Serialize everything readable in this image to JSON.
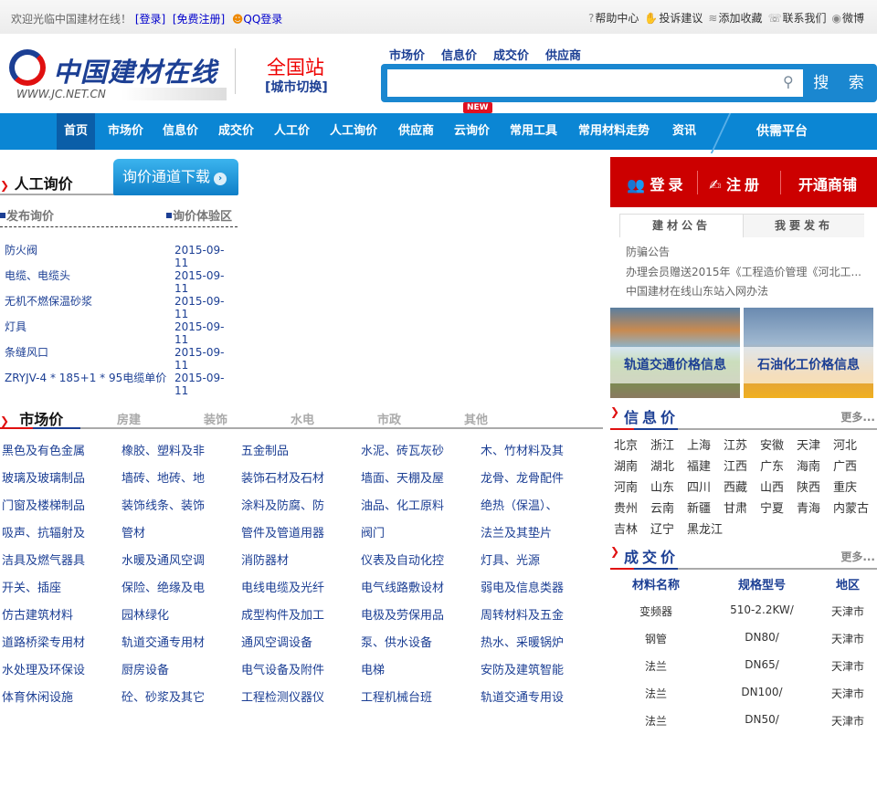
{
  "topbar": {
    "welcome": "欢迎光临中国建材在线！",
    "login": "[登录]",
    "register": "[免费注册]",
    "qq_login": "QQ登录",
    "links": [
      {
        "icon": "help-icon",
        "glyph": "?",
        "label": "帮助中心"
      },
      {
        "icon": "complaint-icon",
        "glyph": "✋",
        "label": "投诉建议"
      },
      {
        "icon": "bookmark-icon",
        "glyph": "≋",
        "label": "添加收藏"
      },
      {
        "icon": "phone-icon",
        "glyph": "☏",
        "label": "联系我们"
      },
      {
        "icon": "weibo-icon",
        "glyph": "◉",
        "label": "微博"
      }
    ]
  },
  "header": {
    "logo_text": "中国建材在线",
    "logo_url": "WWW.JC.NET.CN",
    "station": "全国站",
    "city_switch": "[城市切换]",
    "search_tabs": [
      "市场价",
      "信息价",
      "成交价",
      "供应商"
    ],
    "search_value": "",
    "search_button": "搜 索"
  },
  "nav": {
    "items": [
      "首页",
      "市场价",
      "信息价",
      "成交价",
      "人工价",
      "人工询价",
      "供应商",
      "云询价",
      "常用工具",
      "常用材料走势",
      "资讯",
      "供需平台"
    ],
    "active": "首页",
    "new_badge": "NEW"
  },
  "inquiry": {
    "title": "人工询价",
    "download": "询价通道下载",
    "publish": "发布询价",
    "experience": "询价体验区",
    "rows": [
      {
        "name": "防火阀",
        "date": "2015-09-11"
      },
      {
        "name": "电缆、电缆头",
        "date": "2015-09-11"
      },
      {
        "name": "无机不燃保温砂浆",
        "date": "2015-09-11"
      },
      {
        "name": "灯具",
        "date": "2015-09-11"
      },
      {
        "name": "条缝风口",
        "date": "2015-09-11"
      },
      {
        "name": "ZRYJV-4 * 185+1 * 95电缆单价",
        "date": "2015-09-11"
      }
    ]
  },
  "market": {
    "title": "市场价",
    "tabs": [
      "房建",
      "装饰",
      "水电",
      "市政",
      "其他"
    ],
    "categories": [
      "黑色及有色金属",
      "橡胶、塑料及非",
      "五金制品",
      "水泥、砖瓦灰砂",
      "木、竹材料及其",
      "玻璃及玻璃制品",
      "墙砖、地砖、地",
      "装饰石材及石材",
      "墙面、天棚及屋",
      "龙骨、龙骨配件",
      "门窗及楼梯制品",
      "装饰线条、装饰",
      "涂料及防腐、防",
      "油品、化工原料",
      "绝热（保温）、",
      "吸声、抗辐射及",
      "管材",
      "管件及管道用器",
      "阀门",
      "法兰及其垫片",
      "洁具及燃气器具",
      "水暖及通风空调",
      "消防器材",
      "仪表及自动化控",
      "灯具、光源",
      "开关、插座",
      "保险、绝缘及电",
      "电线电缆及光纤",
      "电气线路敷设材",
      "弱电及信息类器",
      "仿古建筑材料",
      "园林绿化",
      "成型构件及加工",
      "电极及劳保用品",
      "周转材料及五金",
      "道路桥梁专用材",
      "轨道交通专用材",
      "通风空调设备",
      "泵、供水设备",
      "热水、采暖锅炉",
      "水处理及环保设",
      "厨房设备",
      "电气设备及附件",
      "电梯",
      "安防及建筑智能",
      "体育休闲设施",
      "砼、砂浆及其它",
      "工程检测仪器仪",
      "工程机械台班",
      "轨道交通专用设"
    ]
  },
  "member": {
    "login": "登录",
    "register": "注册",
    "open_shop": "开通商铺"
  },
  "notice": {
    "tabs": [
      "建材公告",
      "我要发布"
    ],
    "items": [
      "防骗公告",
      "办理会员赠送2015年《工程造价管理《河北工...",
      "中国建材在线山东站入网办法"
    ]
  },
  "banners": [
    "轨道交通价格信息",
    "石油化工价格信息"
  ],
  "info_price": {
    "title": "信息价",
    "more": "更多...",
    "provinces": [
      "北京",
      "浙江",
      "上海",
      "江苏",
      "安徽",
      "天津",
      "河北",
      "湖南",
      "湖北",
      "福建",
      "江西",
      "广东",
      "海南",
      "广西",
      "河南",
      "山东",
      "四川",
      "西藏",
      "山西",
      "陕西",
      "重庆",
      "贵州",
      "云南",
      "新疆",
      "甘肃",
      "宁夏",
      "青海",
      "内蒙古",
      "吉林",
      "辽宁",
      "黑龙江"
    ]
  },
  "deal_price": {
    "title": "成交价",
    "more": "更多...",
    "headers": [
      "材料名称",
      "规格型号",
      "地区"
    ],
    "rows": [
      [
        "变频器",
        "510-2.2KW/",
        "天津市"
      ],
      [
        "钢管",
        "DN80/",
        "天津市"
      ],
      [
        "法兰",
        "DN65/",
        "天津市"
      ],
      [
        "法兰",
        "DN100/",
        "天津市"
      ],
      [
        "法兰",
        "DN50/",
        "天津市"
      ]
    ]
  },
  "colors": {
    "brand_blue": "#1c3f94",
    "nav_blue": "#0b86d4",
    "accent_red": "#cc0000"
  }
}
